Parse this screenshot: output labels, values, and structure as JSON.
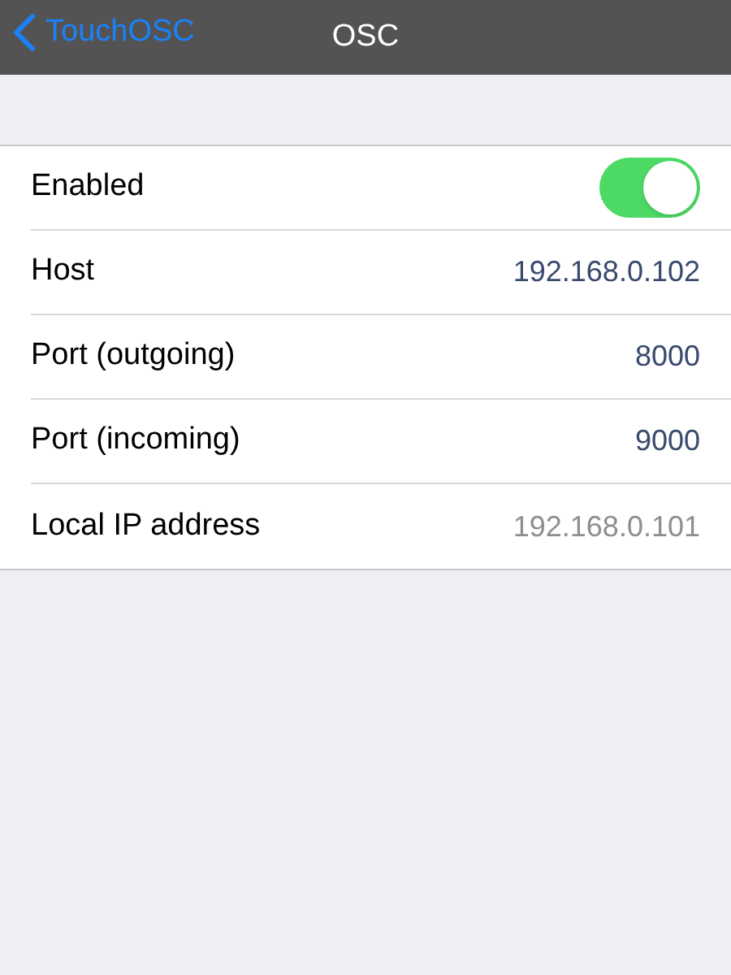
{
  "nav_bar": {
    "back_label": "TouchOSC",
    "title": "OSC"
  },
  "settings": [
    {
      "kind": "toggle",
      "label": "Enabled",
      "on": true
    },
    {
      "kind": "value",
      "label": "Host",
      "value": "192.168.0.102"
    },
    {
      "kind": "value",
      "label": "Port (outgoing)",
      "value": "8000"
    },
    {
      "kind": "value",
      "label": "Port (incoming)",
      "value": "9000"
    },
    {
      "kind": "readonly",
      "label": "Local IP address",
      "value": "192.168.0.101"
    }
  ]
}
